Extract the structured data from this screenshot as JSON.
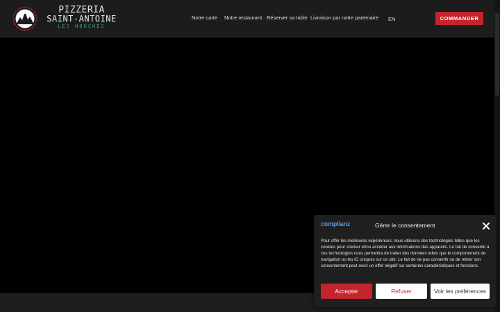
{
  "logo": {
    "line1": "PIZZERIA",
    "line2": "SAINT-ANTOINE",
    "line3": "LES HOUCHES",
    "accent": "#c4242c",
    "green": "#2bb36b"
  },
  "nav": {
    "items": [
      {
        "label": "Notre carte"
      },
      {
        "label": "Notre restaurant"
      },
      {
        "label": "Réserver sa table"
      },
      {
        "label": "Livraison par notre partenaire"
      }
    ],
    "lang": "EN",
    "cta": "COMMANDER"
  },
  "consent": {
    "brand": "complianz",
    "title": "Gérer le consentement",
    "text": "Pour offrir les meilleures expériences, nous utilisons des technologies telles que les cookies pour stocker et/ou accéder aux informations des appareils. Le fait de consentir à ces technologies nous permettra de traiter des données telles que le comportement de navigation ou les ID uniques sur ce site. Le fait de ne pas consentir ou de retirer son consentement peut avoir un effet négatif sur certaines caractéristiques et fonctions.",
    "accept": "Accepter",
    "refuse": "Refuser",
    "prefs": "Voir les préférences",
    "icons": {
      "close": "close-icon"
    }
  },
  "colors": {
    "header": "#1c1c1c",
    "background": "#000000",
    "primary": "#c4242c"
  }
}
